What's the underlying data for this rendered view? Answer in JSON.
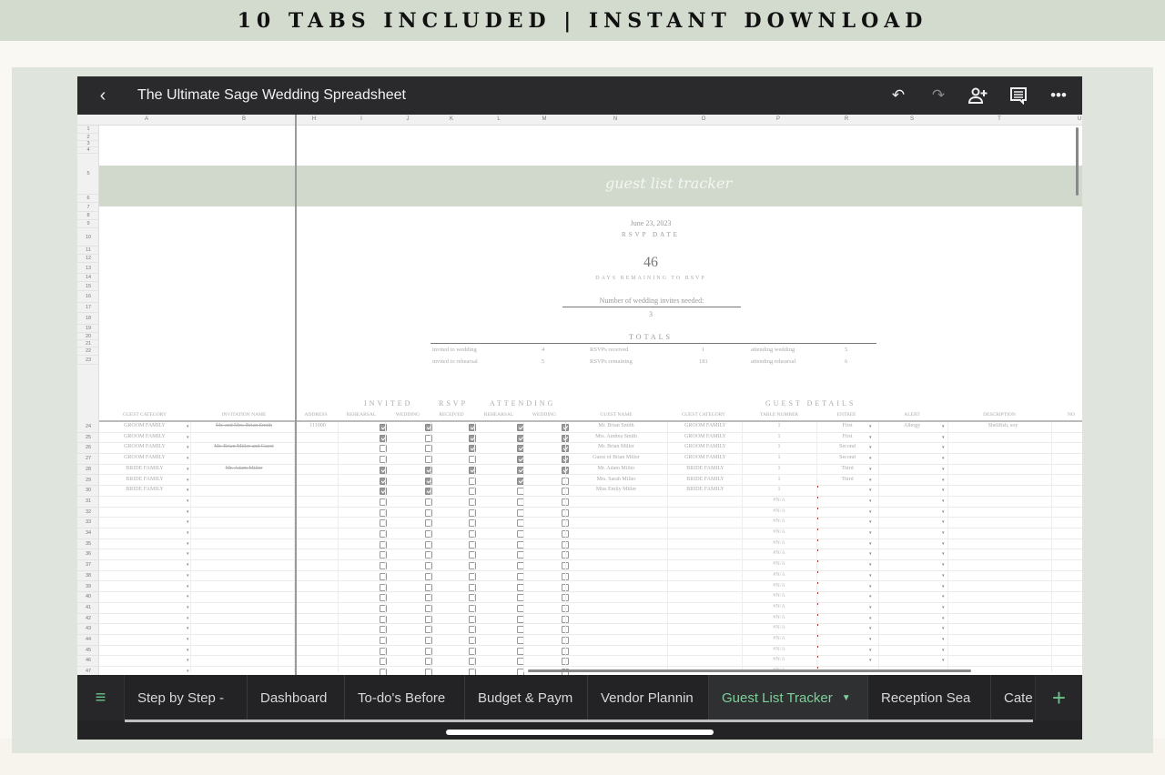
{
  "banner": {
    "text": "10 TABS INCLUDED | INSTANT DOWNLOAD"
  },
  "app": {
    "title": "The Ultimate Sage Wedding Spreadsheet",
    "icons": [
      "back-icon",
      "undo-icon",
      "redo-icon",
      "share-add-person-icon",
      "comment-icon",
      "more-icon"
    ]
  },
  "columns": [
    "A",
    "B",
    "H",
    "I",
    "J",
    "K",
    "L",
    "M",
    "N",
    "O",
    "P",
    "R",
    "S",
    "T",
    "U"
  ],
  "rows_top": [
    "1",
    "2",
    "3",
    "4",
    "5",
    "6",
    "7",
    "8",
    "9",
    "10",
    "11",
    "12",
    "13",
    "14",
    "15",
    "16",
    "17",
    "18",
    "19",
    "20",
    "21",
    "22",
    "23"
  ],
  "sheet": {
    "title": "guest list tracker",
    "rsvp_date": "June 23, 2023",
    "rsvp_date_label": "RSVP DATE",
    "days_remaining": "46",
    "days_remaining_label": "DAYS REMAINING TO RSVP",
    "invites_needed_label": "Number of wedding invites needed:",
    "invites_needed": "3",
    "totals_title": "TOTALS",
    "totals": [
      {
        "label": "invited to wedding",
        "value": "4"
      },
      {
        "label": "invited to rehearsal",
        "value": "5"
      },
      {
        "label": "RSVPs received",
        "value": "1"
      },
      {
        "label": "RSVPs remaining",
        "value": "181"
      },
      {
        "label": "attending wedding",
        "value": "5"
      },
      {
        "label": "attending rehearsal",
        "value": "6"
      }
    ]
  },
  "table": {
    "groups": {
      "invited": "INVITED",
      "rsvp": "RSVP",
      "attending": "ATTENDING",
      "guest_details": "GUEST DETAILS"
    },
    "headers": {
      "guest_category": "GUEST CATEGORY",
      "invitation_name": "INVITATION NAME",
      "address": "ADDRESS",
      "invited_rehearsal": "REHEARSAL",
      "invited_wedding": "WEDDING",
      "rsvp_received": "RECEIVED",
      "attending_rehearsal": "REHEARSAL",
      "attending_wedding": "WEDDING",
      "guest_name": "GUEST NAME",
      "guest_category2": "GUEST CATEGORY",
      "table_number": "TABLE NUMBER",
      "entree": "ENTREE",
      "alert": "ALERT",
      "description": "DESCRIPTION",
      "notes": "NO"
    },
    "rows": [
      {
        "n": "24",
        "category": "GROOM FAMILY",
        "invitation": "Mr. and Mrs. Brian Smith",
        "address": "111000",
        "inv_reh": true,
        "inv_wed": true,
        "rsvp": true,
        "att_reh": true,
        "att_wed": true,
        "guest": "Mr. Brian Smith",
        "gcat": "GROOM FAMILY",
        "table": "1",
        "entree": "First",
        "alert": "Allergy",
        "desc": "Shellfish, soy"
      },
      {
        "n": "25",
        "category": "GROOM FAMILY",
        "invitation": "",
        "address": "",
        "inv_reh": true,
        "inv_wed": false,
        "rsvp": true,
        "att_reh": true,
        "att_wed": true,
        "guest": "Mrs. Andrea Smith",
        "gcat": "GROOM FAMILY",
        "table": "1",
        "entree": "First",
        "alert": "",
        "desc": ""
      },
      {
        "n": "26",
        "category": "GROOM FAMILY",
        "invitation": "Mr. Brian Miller and Guest",
        "address": "",
        "inv_reh": false,
        "inv_wed": false,
        "rsvp": true,
        "att_reh": true,
        "att_wed": true,
        "guest": "Mr. Brian Miller",
        "gcat": "GROOM FAMILY",
        "table": "1",
        "entree": "Second",
        "alert": "",
        "desc": ""
      },
      {
        "n": "27",
        "category": "GROOM FAMILY",
        "invitation": "",
        "address": "",
        "inv_reh": false,
        "inv_wed": false,
        "rsvp": false,
        "att_reh": true,
        "att_wed": true,
        "guest": "Guest of Brian Miller",
        "gcat": "GROOM FAMILY",
        "table": "1",
        "entree": "Second",
        "alert": "",
        "desc": ""
      },
      {
        "n": "28",
        "category": "BRIDE FAMILY",
        "invitation": "Mr. Adam Miller",
        "address": "",
        "inv_reh": true,
        "inv_wed": true,
        "rsvp": true,
        "att_reh": true,
        "att_wed": true,
        "guest": "Mr. Adam Miller",
        "gcat": "BRIDE FAMILY",
        "table": "1",
        "entree": "Third",
        "alert": "",
        "desc": ""
      },
      {
        "n": "29",
        "category": "BRIDE FAMILY",
        "invitation": "",
        "address": "",
        "inv_reh": true,
        "inv_wed": true,
        "rsvp": false,
        "att_reh": true,
        "att_wed": false,
        "guest": "Mrs. Sarah Miller",
        "gcat": "BRIDE FAMILY",
        "table": "1",
        "entree": "Third",
        "alert": "",
        "desc": ""
      },
      {
        "n": "30",
        "category": "BRIDE FAMILY",
        "invitation": "",
        "address": "",
        "inv_reh": true,
        "inv_wed": true,
        "rsvp": false,
        "att_reh": false,
        "att_wed": false,
        "guest": "Miss Emily Miller",
        "gcat": "BRIDE FAMILY",
        "table": "1",
        "entree": "",
        "alert": "",
        "desc": ""
      }
    ],
    "empty_rows": [
      "31",
      "32",
      "33",
      "34",
      "35",
      "36",
      "37",
      "38",
      "39",
      "40",
      "41",
      "42",
      "43",
      "44",
      "45",
      "46",
      "47"
    ],
    "na_value": "#N/A"
  },
  "tabs": {
    "items": [
      {
        "label": "Step by Step -",
        "active": false
      },
      {
        "label": "Dashboard",
        "active": false
      },
      {
        "label": "To-do's Before",
        "active": false
      },
      {
        "label": "Budget & Paym",
        "active": false
      },
      {
        "label": "Vendor Plannin",
        "active": false
      },
      {
        "label": "Guest List Tracker",
        "active": true
      },
      {
        "label": "Reception Sea",
        "active": false
      },
      {
        "label": "Cate",
        "active": false
      }
    ],
    "add_label": "+",
    "menu_icon": "menu-icon"
  }
}
